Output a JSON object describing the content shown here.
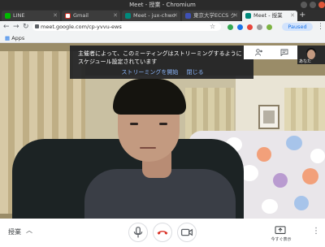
{
  "window": {
    "title": "Meet - 授業 - Chromium"
  },
  "tabs": [
    {
      "label": "LINE",
      "favicon_color": "#00b900"
    },
    {
      "label": "Gmail",
      "favicon_color": "#d93025"
    },
    {
      "label": "Meet - jux-chwo",
      "favicon_color": "#00897b"
    },
    {
      "label": "東京大学ECCS ク",
      "favicon_color": "#3f51b5"
    },
    {
      "label": "Meet - 授業",
      "favicon_color": "#00897b",
      "active": true
    }
  ],
  "toolbar": {
    "url": "meet.google.com/cp-yvvu-ews",
    "paused_label": "Paused"
  },
  "bookmarks": {
    "apps_label": "Apps"
  },
  "banner": {
    "message": "主催者によって、このミーティングはストリーミングするようにスケジュール設定されています",
    "start_label": "ストリーミングを開始",
    "close_label": "閉じる"
  },
  "self_view": {
    "label": "あなた"
  },
  "bottom": {
    "details_label": "授業",
    "present_label": "今すぐ表示"
  },
  "colors": {
    "accent_blue": "#1a73e8",
    "hangup_red": "#d93025",
    "banner_bg": "#202124"
  },
  "icons": {
    "people": "people-icon",
    "chat": "chat-icon",
    "mic": "mic-icon",
    "hangup": "hangup-icon",
    "camera": "camera-icon",
    "present": "present-icon",
    "more": "more-vert-icon"
  }
}
